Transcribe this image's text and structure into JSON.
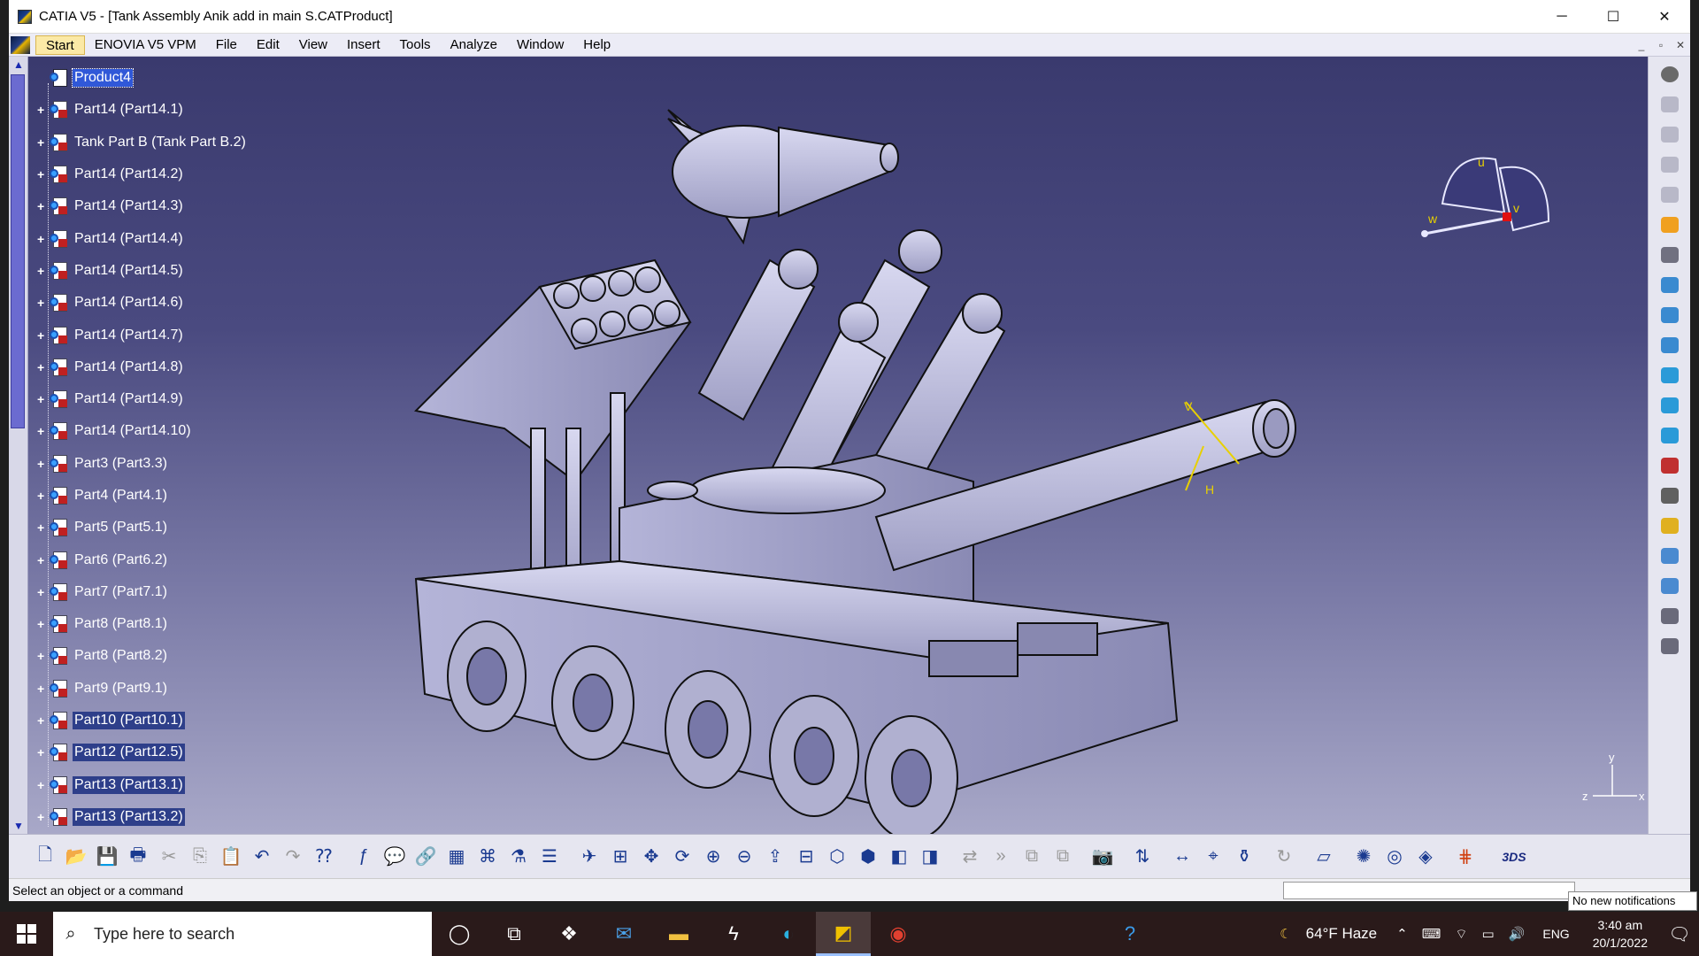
{
  "window": {
    "title": "CATIA V5 - [Tank Assembly Anik add in main S.CATProduct]",
    "minimize": "─",
    "maximize": "☐",
    "close": "✕"
  },
  "menu": {
    "items": [
      "Start",
      "ENOVIA V5 VPM",
      "File",
      "Edit",
      "View",
      "Insert",
      "Tools",
      "Analyze",
      "Window",
      "Help"
    ],
    "mdi": [
      "_",
      "▫",
      "✕"
    ]
  },
  "tree": {
    "root": "Product4",
    "nodes": [
      "Part14 (Part14.1)",
      "Tank Part B (Tank Part B.2)",
      "Part14 (Part14.2)",
      "Part14 (Part14.3)",
      "Part14 (Part14.4)",
      "Part14 (Part14.5)",
      "Part14 (Part14.6)",
      "Part14 (Part14.7)",
      "Part14 (Part14.8)",
      "Part14 (Part14.9)",
      "Part14 (Part14.10)",
      "Part3 (Part3.3)",
      "Part4 (Part4.1)",
      "Part5 (Part5.1)",
      "Part6 (Part6.2)",
      "Part7 (Part7.1)",
      "Part8 (Part8.1)",
      "Part8 (Part8.2)",
      "Part9 (Part9.1)",
      "Part10 (Part10.1)",
      "Part12 (Part12.5)",
      "Part13 (Part13.1)",
      "Part13 (Part13.2)"
    ]
  },
  "compass": {
    "u": "u",
    "v": "v",
    "w": "w"
  },
  "axis": {
    "x": "x",
    "y": "y",
    "z": "z"
  },
  "robot": {
    "v": "V",
    "h": "H"
  },
  "status": {
    "message": "Select an object or a command",
    "notification": "No new notifications"
  },
  "taskbar": {
    "search_placeholder": "Type here to search",
    "weather": "64°F  Haze",
    "language": "ENG",
    "time": "3:40 am",
    "date": "20/1/2022"
  }
}
